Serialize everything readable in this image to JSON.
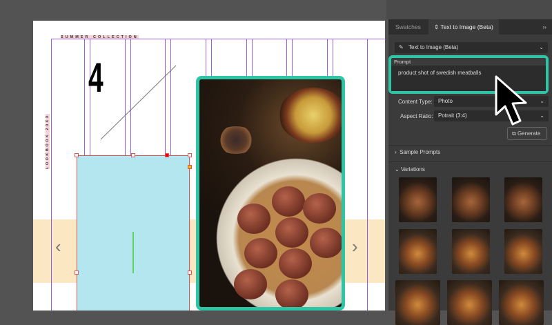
{
  "canvas": {
    "header_text": "SUMMER COLLECTION",
    "side_text": "LOOKBOOK 20XX",
    "big_number": "4",
    "prev_arrow": "‹",
    "next_arrow": "›"
  },
  "panel": {
    "tabs": [
      {
        "label": "Swatches"
      },
      {
        "label": "Text to Image (Beta)"
      }
    ],
    "collapse": "››",
    "mode_dropdown": "Text to Image (Beta)",
    "prompt_label": "Prompt",
    "prompt_value": "product shot of swedish meatballs",
    "content_type_label": "Content Type:",
    "content_type_value": "Photo",
    "aspect_ratio_label": "Aspect Ratio:",
    "aspect_ratio_value": "Potrait (3:4)",
    "generate": "Generate",
    "sample_prompts": "Sample Prompts",
    "variations": "Variations"
  },
  "colors": {
    "accent": "#2ec4a6",
    "guide": "#9b5de5",
    "selection": "#e05555"
  }
}
